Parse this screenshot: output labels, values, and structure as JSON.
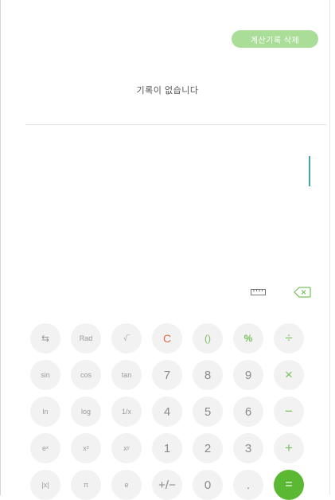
{
  "history": {
    "clear_label": "계산기록 삭제",
    "empty_text": "기록이 없습니다"
  },
  "icons": {
    "ruler": "ruler-icon",
    "backspace": "backspace-icon",
    "cursor": "text-cursor"
  },
  "colors": {
    "accent": "#76c05b",
    "equals_bg": "#5ab833",
    "clear_btn_bg": "#a9dd98",
    "clear_key": "#e06b4a",
    "cursor": "#3fa5a7"
  },
  "keypad": {
    "row1": [
      "⇆",
      "Rad",
      "√‾",
      "C",
      "()",
      "%",
      "÷"
    ],
    "row2": [
      "sin",
      "cos",
      "tan",
      "7",
      "8",
      "9",
      "×"
    ],
    "row3": [
      "ln",
      "log",
      "1/x",
      "4",
      "5",
      "6",
      "−"
    ],
    "row4": [
      "eˣ",
      "x²",
      "xʸ",
      "1",
      "2",
      "3",
      "+"
    ],
    "row5": [
      "|x|",
      "π",
      "e",
      "+/−",
      "0",
      ".",
      "="
    ]
  }
}
